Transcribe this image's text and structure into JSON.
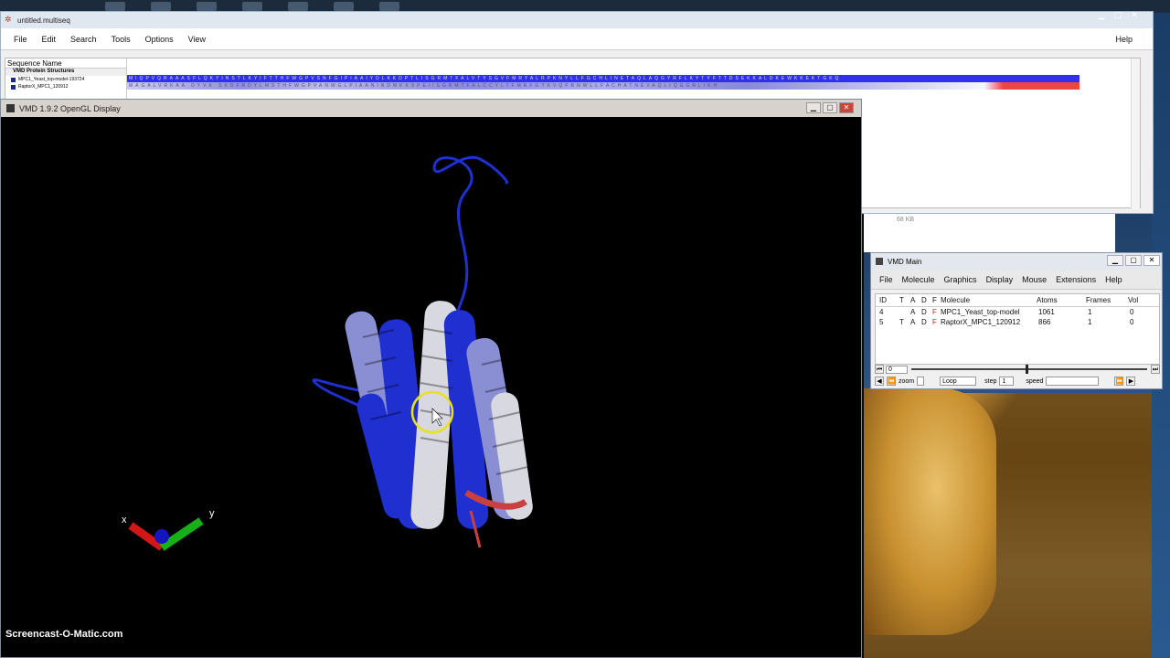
{
  "multiseq_window": {
    "title": "untitled.multiseq",
    "menu": [
      "File",
      "Edit",
      "Search",
      "Tools",
      "Options",
      "View"
    ],
    "help": "Help",
    "sequence_header": "Sequence Name",
    "group_label": "VMD Protein Structures",
    "sequences": [
      {
        "name": "MPC1_Yeast_top-model-193724",
        "residues": "MIQPVQRAAASFLQKYINSTLKYIFTTHFWGPVSNFGIPIAAIYDLKKDPTLISGRMTFALVTYSGVFMRYALRPKNYLLFGCHLINETAQLAQGYRFLKYTYFTTDSEKKALDKEWKKEKTGKQ"
      },
      {
        "name": "RaptorX_MPC1_120912",
        "residues": "MAGALVRKAA DYVK SKDFRDYLMSTHFWGPVANWGLPIAANINDMKKSPEIISGRMTFALCCYLTFMRFGYKVQPRNWLLFACHATNEVAQLIQGGRLIKH"
      }
    ],
    "file_size": "68 KB"
  },
  "opengl_window": {
    "title": "VMD 1.9.2 OpenGL Display",
    "axes": {
      "x": "x",
      "y": "y"
    }
  },
  "watermark": "Screencast-O-Matic.com",
  "vmd_main": {
    "title": "VMD Main",
    "menu": [
      "File",
      "Molecule",
      "Graphics",
      "Display",
      "Mouse",
      "Extensions",
      "Help"
    ],
    "columns": {
      "id": "ID",
      "t": "T",
      "a": "A",
      "d": "D",
      "f": "F",
      "molecule": "Molecule",
      "atoms": "Atoms",
      "frames": "Frames",
      "vol": "Vol"
    },
    "molecules": [
      {
        "id": "4",
        "t": "",
        "a": "A",
        "d": "D",
        "f": "F",
        "molecule": "MPC1_Yeast_top-model",
        "atoms": "1061",
        "frames": "1",
        "vol": "0"
      },
      {
        "id": "5",
        "t": "T",
        "a": "A",
        "d": "D",
        "f": "F",
        "molecule": "RaptorX_MPC1_120912",
        "atoms": "866",
        "frames": "1",
        "vol": "0"
      }
    ],
    "frame_value": "0",
    "zoom_label": "zoom",
    "loop_option": "Loop",
    "step_label": "step",
    "step_value": "1",
    "speed_label": "speed"
  },
  "colors": {
    "helix_blue": "#1f2fd0",
    "helix_white": "#d8d8e0",
    "helix_lavender": "#8a8fd4",
    "helix_red": "#c84040",
    "pointer_ring": "#e8e020"
  }
}
